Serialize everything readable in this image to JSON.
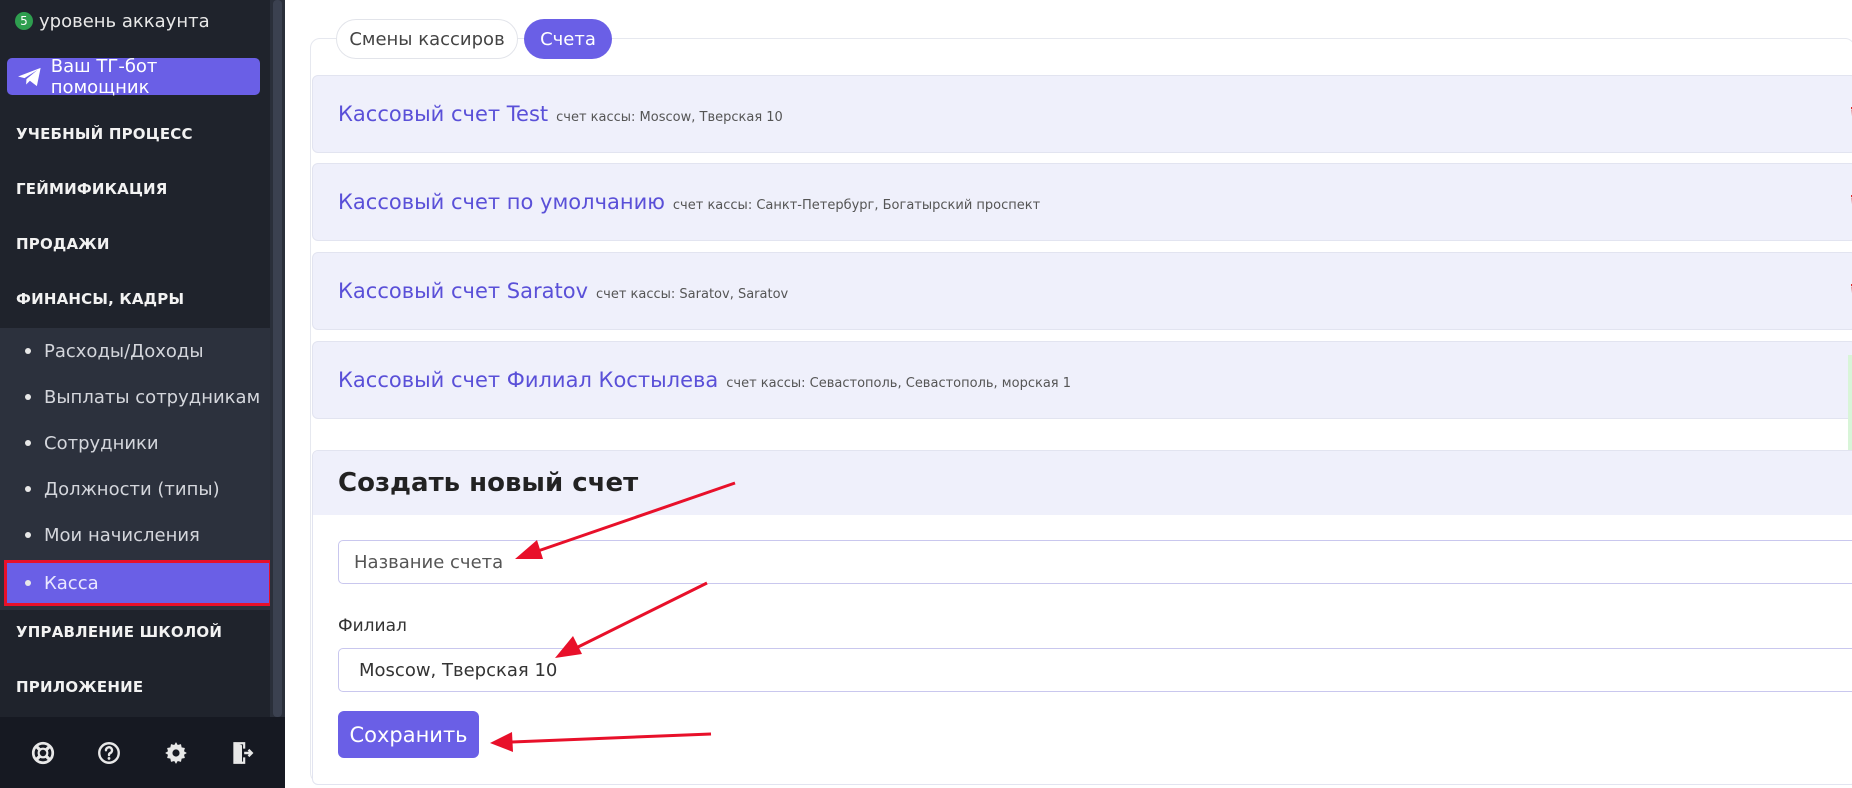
{
  "sidebar": {
    "account_level": {
      "badge": "5",
      "label": "уровень аккаунта"
    },
    "tg_button": {
      "label": "Ваш ТГ-бот помощник",
      "icon": "telegram-icon"
    },
    "sections": {
      "learning": "УЧЕБНЫЙ ПРОЦЕСС",
      "gamification": "ГЕЙМИФИКАЦИЯ",
      "sales": "ПРОДАЖИ",
      "finance": "ФИНАНСЫ, КАДРЫ",
      "school": "УПРАВЛЕНИЕ ШКОЛОЙ",
      "app": "ПРИЛОЖЕНИЕ"
    },
    "finance_items": [
      {
        "label": "Расходы/Доходы"
      },
      {
        "label": "Выплаты сотрудникам"
      },
      {
        "label": "Сотрудники"
      },
      {
        "label": "Должности (типы)"
      },
      {
        "label": "Мои начисления"
      },
      {
        "label": "Касса"
      }
    ],
    "footer_icons": [
      "lifebuoy-icon",
      "help-icon",
      "gear-icon",
      "logout-icon"
    ]
  },
  "tabs": [
    {
      "label": "Смены кассиров",
      "active": false
    },
    {
      "label": "Счета",
      "active": true
    }
  ],
  "accounts": [
    {
      "name": "Кассовый счет Test",
      "meta": "счет кассы: Moscow, Тверская 10"
    },
    {
      "name": "Кассовый счет по умолчанию",
      "meta": "счет кассы: Санкт-Петербург, Богатырский проспект"
    },
    {
      "name": "Кассовый счет Saratov",
      "meta": "счет кассы: Saratov, Saratov"
    },
    {
      "name": "Кассовый счет Филиал Костылева",
      "meta": "счет кассы: Севастополь, Севастополь, морская 1"
    }
  ],
  "form": {
    "title": "Создать новый счет",
    "name_placeholder": "Название счета",
    "branch_label": "Филиал",
    "branch_value": "Moscow, Тверская 10",
    "save_label": "Сохранить"
  },
  "colors": {
    "accent": "#6a5fe6",
    "sidebar_bg": "#1f232c",
    "annotation_red": "#e8102a",
    "delete_red": "#e02a2a"
  }
}
